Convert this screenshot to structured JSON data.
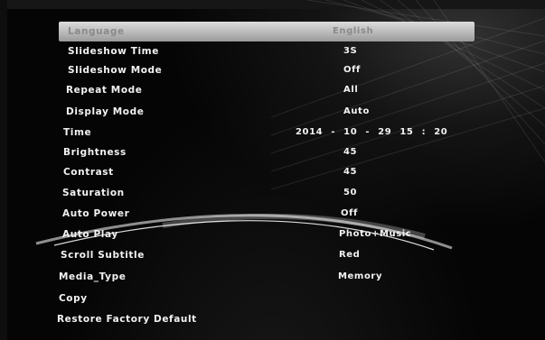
{
  "menu": {
    "items": [
      {
        "label": "Language",
        "value": "English"
      },
      {
        "label": "Slideshow  Time",
        "value": "3S"
      },
      {
        "label": "Slideshow  Mode",
        "value": "Off"
      },
      {
        "label": "Repeat  Mode",
        "value": "All"
      },
      {
        "label": "Display  Mode",
        "value": "Auto"
      },
      {
        "label": "Time",
        "value": "2014 - 10 - 29  15 : 20"
      },
      {
        "label": "Brightness",
        "value": "45"
      },
      {
        "label": "Contrast",
        "value": "45"
      },
      {
        "label": "Saturation",
        "value": "50"
      },
      {
        "label": "Auto  Power",
        "value": "Off"
      },
      {
        "label": "Auto  Play",
        "value": "Photo+Music"
      },
      {
        "label": "Scroll  Subtitle",
        "value": "Red"
      },
      {
        "label": "Media_Type",
        "value": "Memory"
      },
      {
        "label": "Copy",
        "value": ""
      },
      {
        "label": "Restore  Factory  Default",
        "value": ""
      }
    ],
    "selected_index": 0
  },
  "colors": {
    "background": "#050505",
    "text": "#f2f2f2",
    "highlight": "#c8c8c8",
    "highlight_text": "#8a8a8a"
  }
}
